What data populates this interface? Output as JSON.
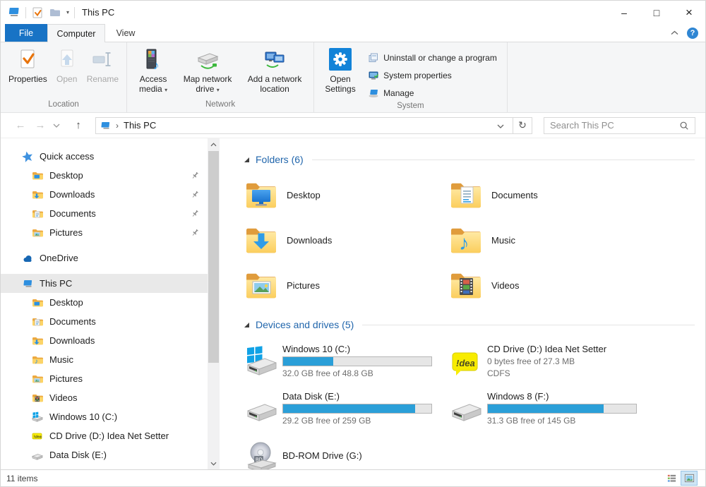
{
  "window": {
    "title": "This PC"
  },
  "glyphs": {
    "caret_down": "▾",
    "crumb_sep": "›",
    "back_arrow": "←",
    "forward_arrow": "→",
    "up_arrow": "↑",
    "refresh": "↻",
    "minimize": "–",
    "maximize": "□",
    "close": "×",
    "help": "?",
    "music_note": "♪"
  },
  "tabs": {
    "file": "File",
    "computer": "Computer",
    "view": "View"
  },
  "ribbon": {
    "location": {
      "label": "Location",
      "properties": "Properties",
      "open": "Open",
      "rename": "Rename"
    },
    "network": {
      "label": "Network",
      "access_media": "Access media",
      "map_drive": "Map network drive",
      "add_location": "Add a network location"
    },
    "system": {
      "label": "System",
      "open_settings": "Open Settings",
      "uninstall": "Uninstall or change a program",
      "sys_props": "System properties",
      "manage": "Manage"
    }
  },
  "nav": {
    "breadcrumb_root": "This PC",
    "search_placeholder": "Search This PC"
  },
  "sidebar": {
    "quick_access": {
      "label": "Quick access",
      "items": [
        "Desktop",
        "Downloads",
        "Documents",
        "Pictures"
      ]
    },
    "onedrive_label": "OneDrive",
    "this_pc": {
      "label": "This PC",
      "items": [
        "Desktop",
        "Documents",
        "Downloads",
        "Music",
        "Pictures",
        "Videos",
        "Windows 10 (C:)",
        "CD Drive (D:) Idea Net Setter",
        "Data Disk (E:)"
      ]
    }
  },
  "main": {
    "folders": {
      "header": "Folders (6)",
      "items": [
        "Desktop",
        "Documents",
        "Downloads",
        "Music",
        "Pictures",
        "Videos"
      ]
    },
    "drives": {
      "header": "Devices and drives (5)",
      "items": [
        {
          "name": "Windows 10 (C:)",
          "free": "32.0 GB free of 48.8 GB",
          "used_pct": 34
        },
        {
          "name": "CD Drive (D:) Idea Net Setter",
          "free": "0 bytes free of 27.3 MB",
          "fs": "CDFS"
        },
        {
          "name": "Data Disk (E:)",
          "free": "29.2 GB free of 259 GB",
          "used_pct": 89
        },
        {
          "name": "Windows 8 (F:)",
          "free": "31.3 GB free of 145 GB",
          "used_pct": 78
        },
        {
          "name": "BD-ROM Drive (G:)"
        }
      ]
    },
    "idea_logo": "!dea",
    "bd_label": "BD"
  },
  "status": {
    "count": "11 items"
  },
  "colors": {
    "accent_tab_blue": "#1873c5",
    "section_header_blue": "#2166ac",
    "drive_bar_fill": "#2b9fd8",
    "folder_yellow": "#fcd467",
    "selection_gray": "#e9e9e9",
    "idea_yellow": "#f8ec00"
  }
}
